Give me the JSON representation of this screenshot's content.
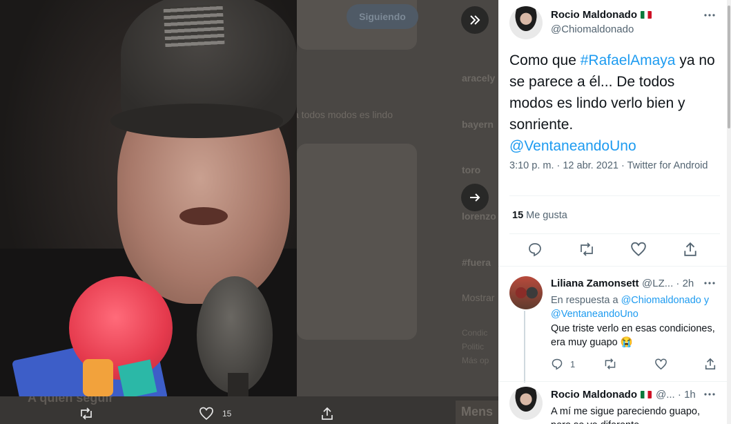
{
  "background": {
    "follow_button": "Siguiendo",
    "trend_handle_1": "aracely",
    "trend_snippet": "a todos modos es lindo",
    "trend_2": "bayern",
    "trend_3": "toro",
    "trend_4": "lorenzo",
    "trend_5": "#fuera",
    "show_more": "Mostrar",
    "footer_1": "Condic",
    "footer_2": "Politic",
    "footer_3": "Más op",
    "who_to_follow": "A quién seguir",
    "messages": "Mens"
  },
  "media_actions": {
    "like_count": "15"
  },
  "tweet": {
    "author_name": "Rocio Maldonado",
    "author_handle": "@Chiomaldonado",
    "text_before": "Como que ",
    "hashtag": "#RafaelAmaya",
    "text_after": " ya no se parece a él... De todos modos es lindo verlo bien y sonriente.",
    "mention": "@VentaneandoUno",
    "timestamp": "3:10 p. m. · 12 abr. 2021 · Twitter for Android",
    "likes_count": "15",
    "likes_label": "Me gusta"
  },
  "replies": [
    {
      "author_name": "Liliana Zamonsett",
      "author_handle": "@LZ...",
      "time": "· 2h",
      "reply_prefix": "En respuesta a ",
      "reply_mention_1": "@Chiomaldonado",
      "reply_joiner": " y ",
      "reply_mention_2": "@VentaneandoUno",
      "text": "Que triste verlo en esas condiciones, era muy guapo 😭",
      "reply_count": "1"
    },
    {
      "author_name": "Rocio Maldonado",
      "author_handle": "@...",
      "time": "· 1h",
      "text": "A mí me sigue pareciendo guapo, pero se ve diferente"
    }
  ],
  "icons": [
    "collapse-icon",
    "next-arrow-icon",
    "retweet-icon",
    "heart-icon",
    "share-icon",
    "reply-icon",
    "more-icon"
  ],
  "colors": {
    "link": "#1d9bf0",
    "text": "#0f1419",
    "muted": "#536471"
  }
}
